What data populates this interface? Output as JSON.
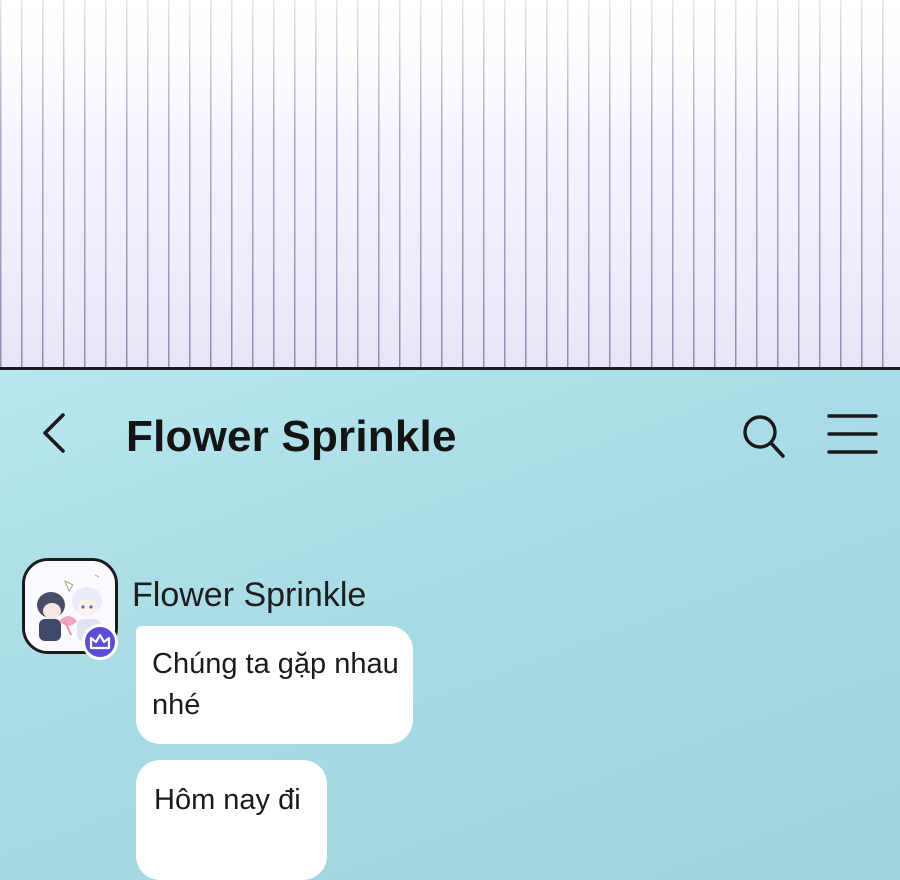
{
  "header": {
    "title": "Flower Sprinkle"
  },
  "icons": {
    "back": "chevron-left-icon",
    "search": "search-icon",
    "menu": "hamburger-menu-icon",
    "badge": "crown-icon"
  },
  "colors": {
    "chat_background": "#a9dce6",
    "bubble": "#ffffff",
    "badge": "#5b4fd6",
    "title_text": "#141414"
  },
  "messages": [
    {
      "sender": "Flower Sprinkle",
      "text": "Chúng ta gặp nhau nhé"
    },
    {
      "sender": "Flower Sprinkle",
      "text": "Hôm nay đi"
    }
  ]
}
